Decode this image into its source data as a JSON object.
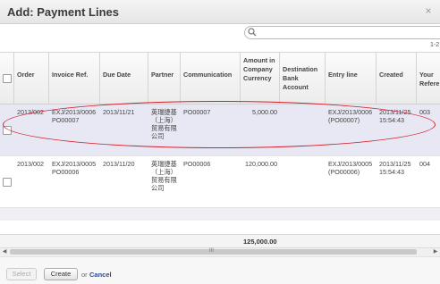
{
  "dialog": {
    "title": "Add: Payment Lines",
    "close_glyph": "×"
  },
  "search": {
    "placeholder": ""
  },
  "pager": {
    "text": "1-2"
  },
  "columns": [
    "Order",
    "Invoice Ref.",
    "Due Date",
    "Partner",
    "Communication",
    "Amount in Company Currency",
    "Destination Bank Account",
    "Entry line",
    "Created",
    "Your Refere"
  ],
  "rows": [
    {
      "order": "2013/002",
      "invoice_ref": "EXJ/2013/0006 PO00007",
      "due_date": "2013/11/21",
      "partner": "英瑞捷基（上海）贸易有限公司",
      "communication": "PO00007",
      "amount": "5,000.00",
      "bank_account": "",
      "entry_line": "EXJ/2013/0006 (PO00007)",
      "created": "2013/11/25 15:54:43",
      "your_ref": "003"
    },
    {
      "order": "2013/002",
      "invoice_ref": "EXJ/2013/0005 PO00006",
      "due_date": "2013/11/20",
      "partner": "英瑞捷基（上海）贸易有限公司",
      "communication": "PO00006",
      "amount": "120,000.00",
      "bank_account": "",
      "entry_line": "EXJ/2013/0005 (PO00006)",
      "created": "2013/11/25 15:54:43",
      "your_ref": "004"
    }
  ],
  "totals": {
    "amount": "125,000.00"
  },
  "scrollbar": {
    "grip": "III"
  },
  "footer": {
    "select_label": "Select",
    "create_label": "Create",
    "or_text": "or",
    "cancel_label": "Cancel"
  },
  "colors": {
    "highlight_ellipse": "#d11f2a",
    "row_selected_bg": "#e8e8f4",
    "cancel_link": "#2a4d93"
  },
  "icons": {
    "search": "search-icon",
    "close": "close-icon"
  }
}
